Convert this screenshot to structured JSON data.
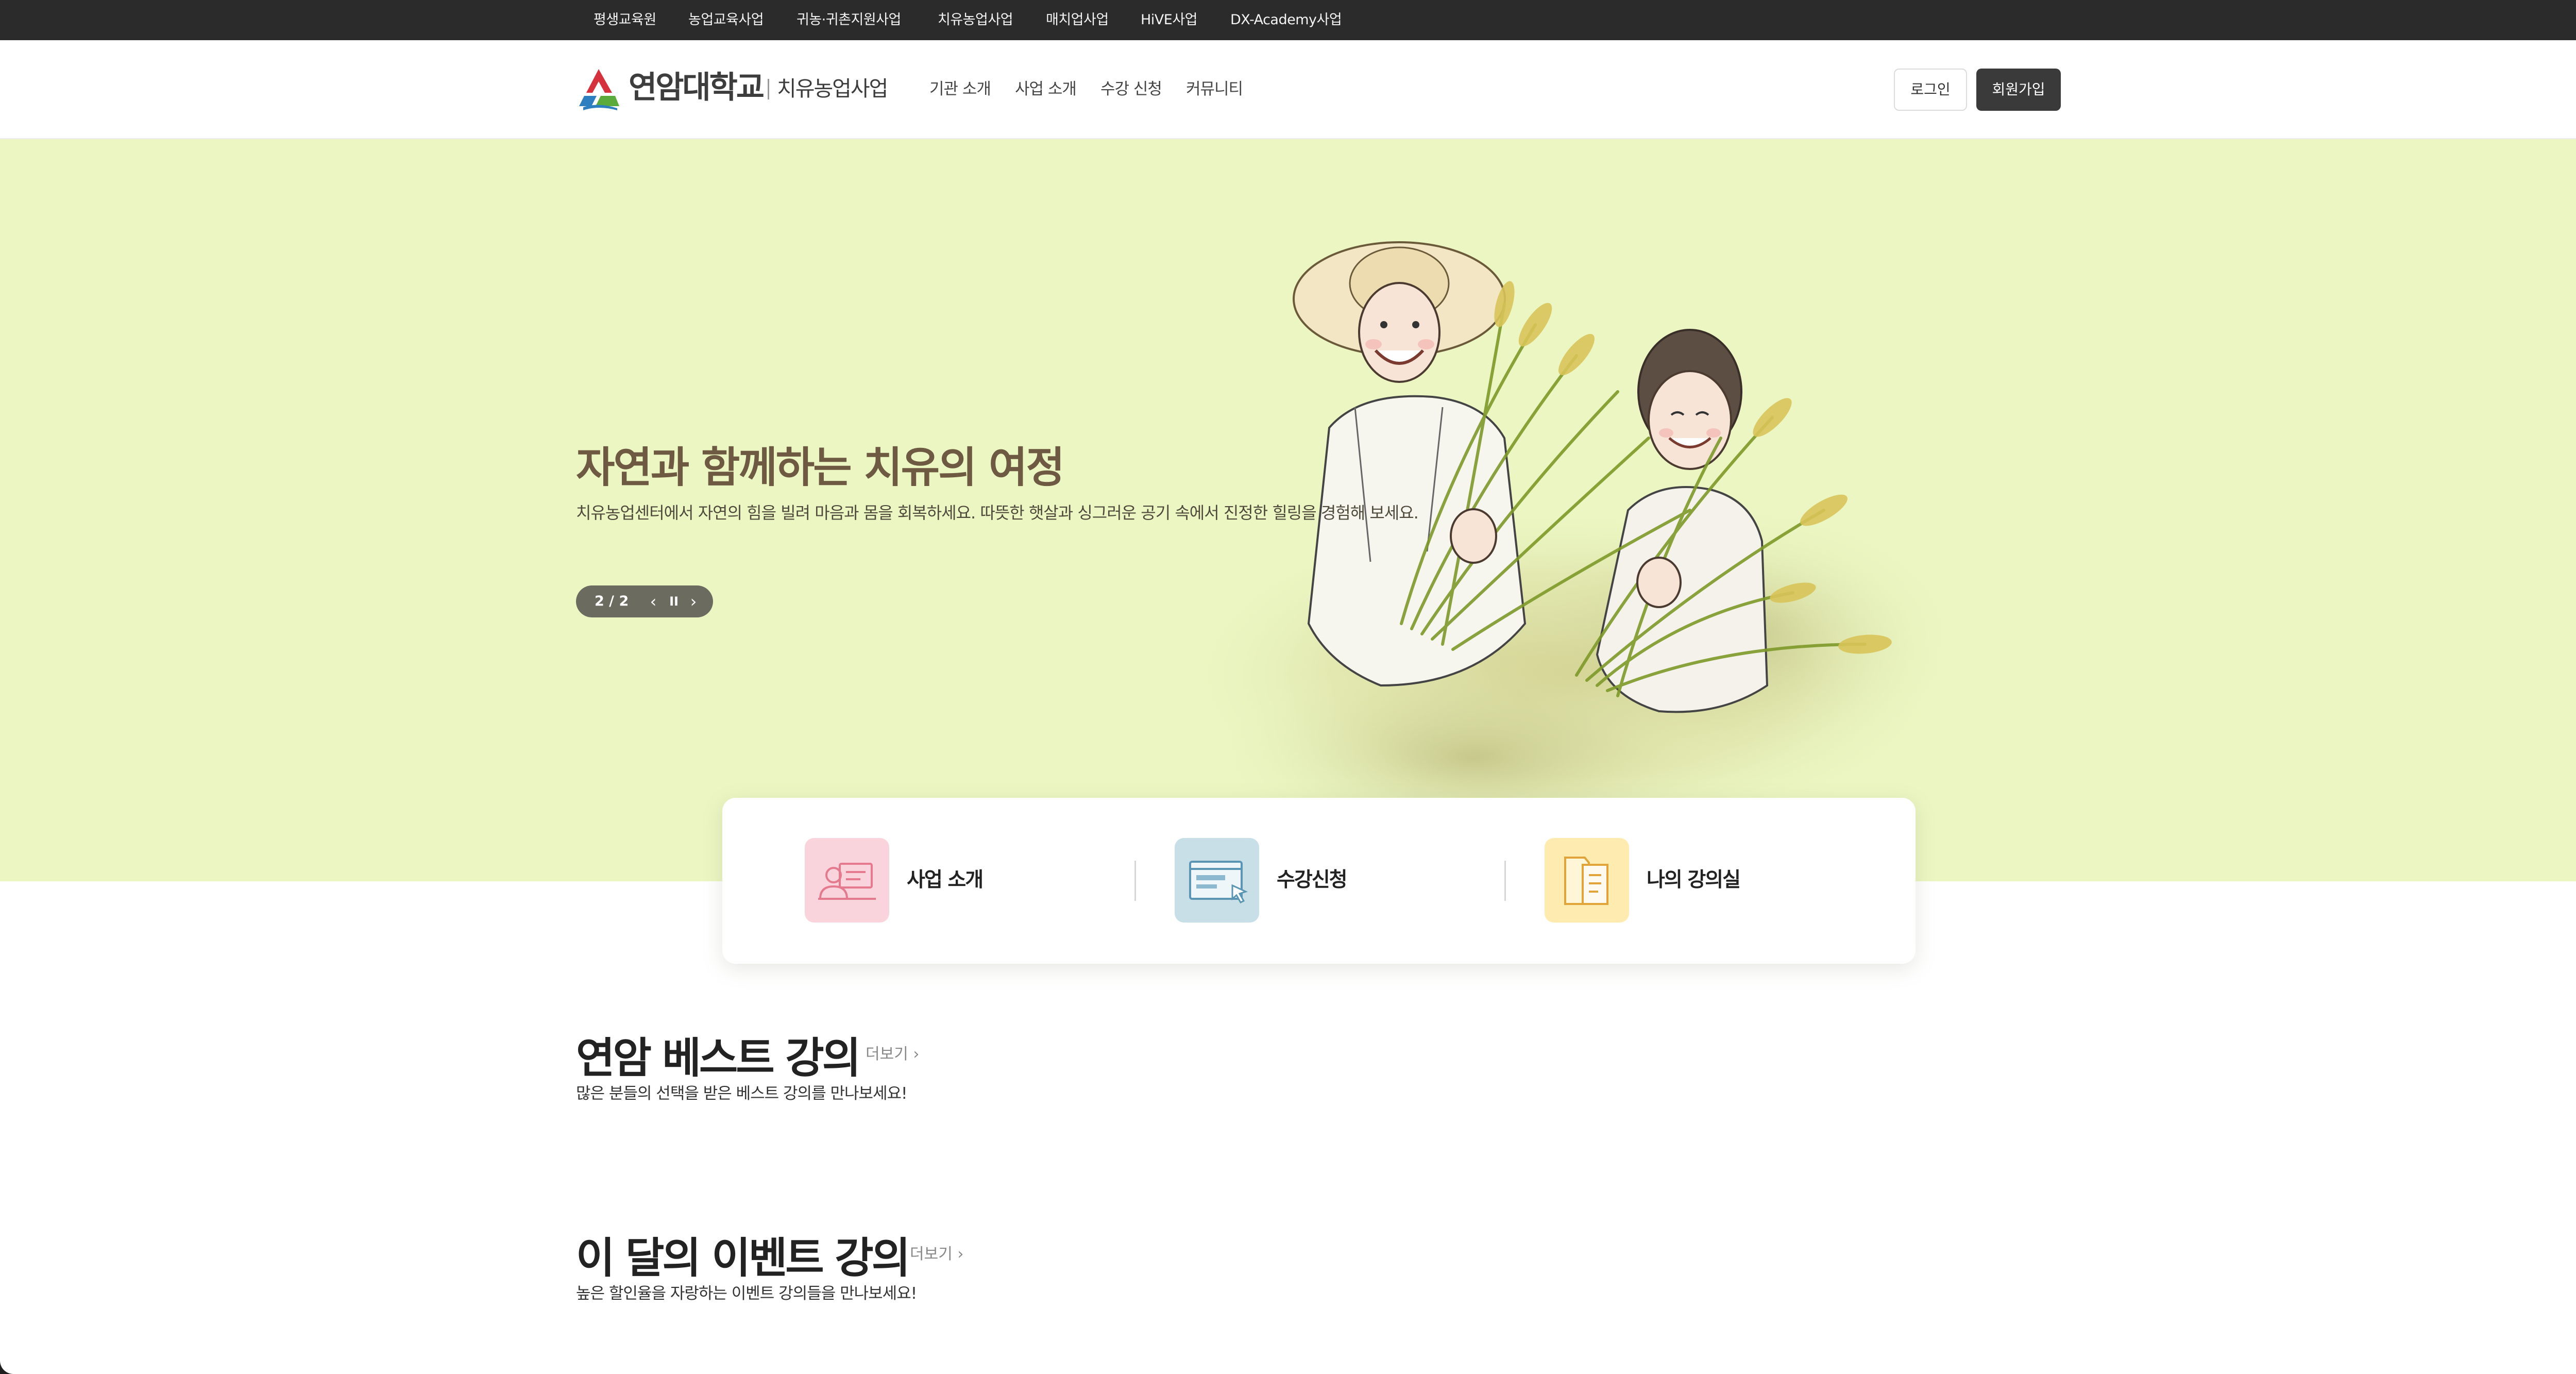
{
  "topbar": {
    "links": [
      "평생교육원",
      "농업교육사업",
      "귀농·귀촌지원사업",
      "치유농업사업",
      "매치업사업",
      "HiVE사업",
      "DX-Academy사업"
    ]
  },
  "header": {
    "logo_text": "연암대학교",
    "logo_sub": "치유농업사업",
    "gnb": [
      "기관 소개",
      "사업 소개",
      "수강 신청",
      "커뮤니티"
    ],
    "login_label": "로그인",
    "join_label": "회원가입"
  },
  "hero": {
    "title": "자연과 함께하는 치유의 여정",
    "description": "치유농업센터에서 자연의 힘을 빌려 마음과 몸을 회복하세요. 따뜻한 햇살과 싱그러운 공기 속에서 진정한 힐링을 경험해 보세요.",
    "pager_count": "2 / 2",
    "pager_prev": "‹",
    "pager_pause": "II",
    "pager_next": "›"
  },
  "quick_menu": {
    "items": [
      "사업 소개",
      "수강신청",
      "나의 강의실"
    ],
    "icons": [
      "presenter-icon",
      "online-course-icon",
      "book-icon"
    ],
    "icon_colors": [
      "#fad4dc",
      "#c8dfe8",
      "#fdebb0"
    ]
  },
  "sections": {
    "best": {
      "title": "연암 베스트 강의",
      "more": "더보기 ›",
      "subtitle": "많은 분들의 선택을 받은 베스트 강의를 만나보세요!"
    },
    "event": {
      "title": "이 달의 이벤트 강의",
      "more": "더보기 ›",
      "subtitle": "높은 할인율을 자랑하는 이벤트 강의들을 만나보세요!"
    }
  },
  "colors": {
    "topbar_bg": "#2b2b2b",
    "hero_bg": "#ebf6c2",
    "hero_title": "#6e5a42",
    "join_button": "#3a3a3a",
    "logo_red": "#d6323e",
    "logo_blue": "#2d7fbf",
    "logo_green": "#5aab3c"
  }
}
